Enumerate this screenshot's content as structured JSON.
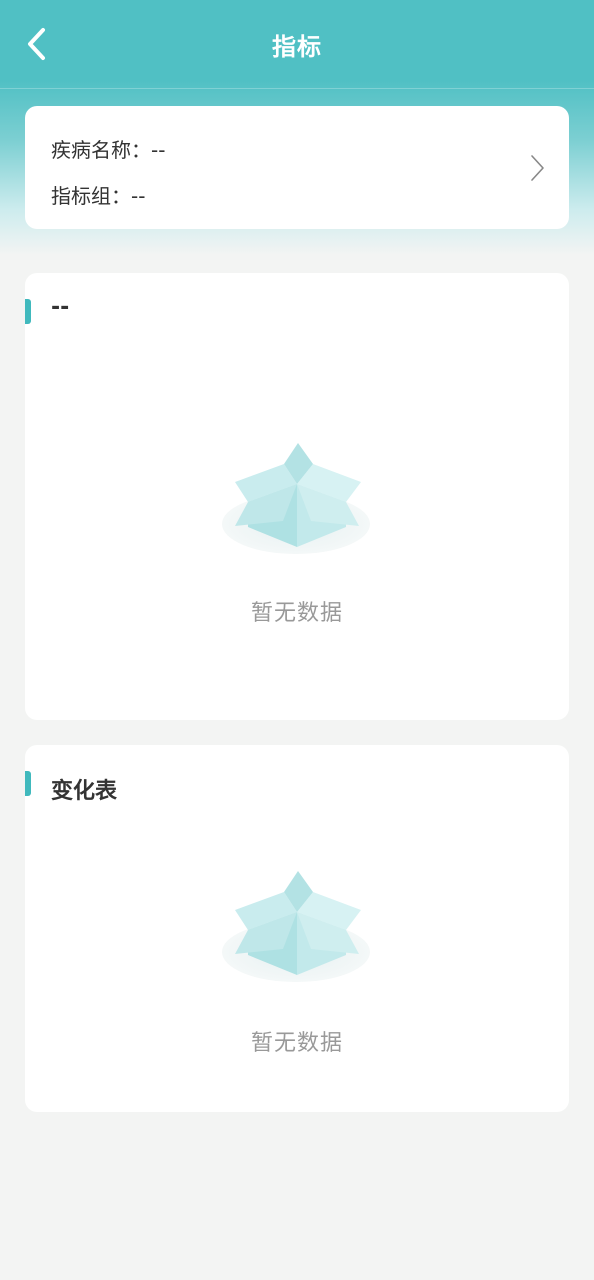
{
  "header": {
    "title": "指标",
    "back_icon": "chevron-left-icon"
  },
  "colors": {
    "primary": "#50c0c4",
    "accent": "#40b9bd",
    "background": "#f3f4f3"
  },
  "info_card": {
    "disease_label": "疾病名称：--",
    "group_label": "指标组：--",
    "arrow_icon": "chevron-right-icon"
  },
  "panels": [
    {
      "title": "--",
      "empty_text": "暂无数据",
      "empty_icon": "empty-box-icon"
    },
    {
      "title": "变化表",
      "empty_text": "暂无数据",
      "empty_icon": "empty-box-icon"
    }
  ]
}
